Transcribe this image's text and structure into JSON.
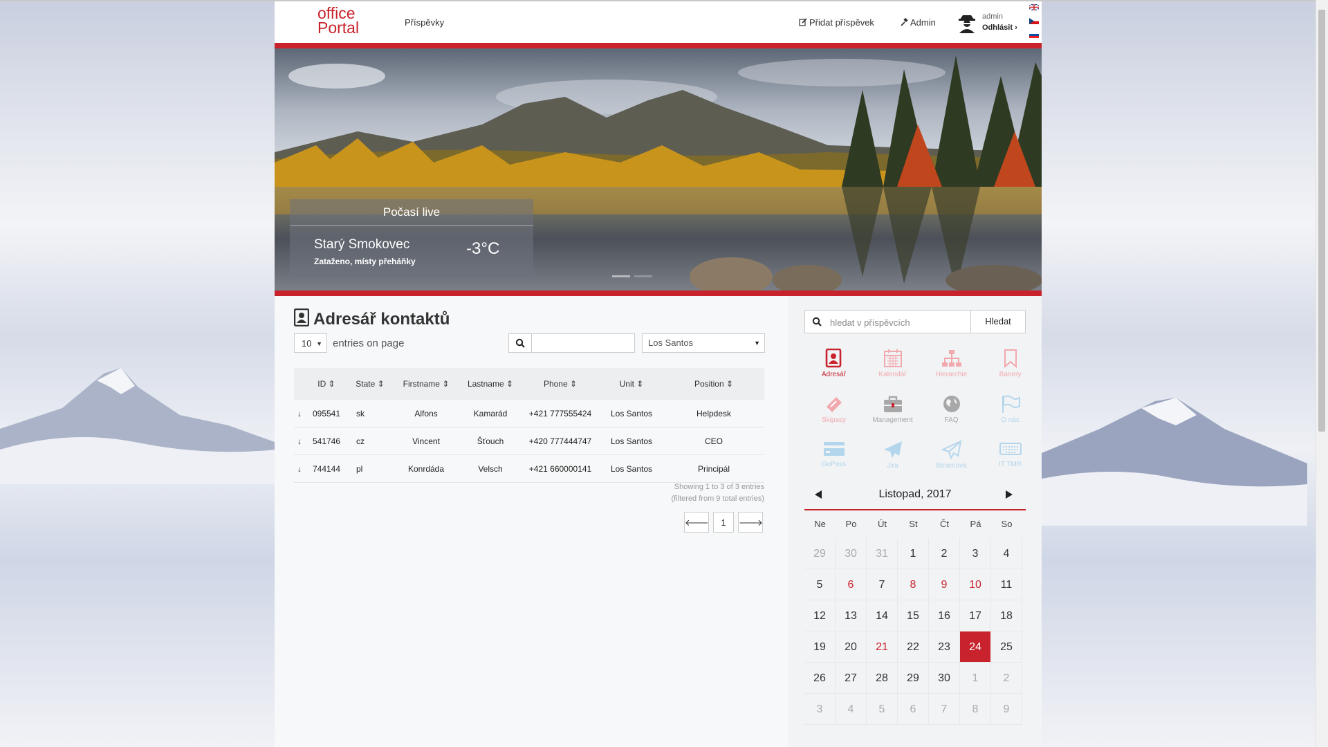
{
  "header": {
    "logo_line1": "office",
    "logo_line2": "Portal",
    "nav_posts": "Příspěvky",
    "add_post": "Přidat příspěvek",
    "admin_link": "Admin",
    "user_name": "admin",
    "logout": "Odhlásit"
  },
  "weather": {
    "title": "Počasí live",
    "city": "Starý Smokovec",
    "condition": "Zataženo, místy přeháňky",
    "temperature": "-3°C"
  },
  "main": {
    "title": "Adresář kontaktů",
    "page_length": "10",
    "entries_label": "entries on page",
    "unit_filter": "Los Santos",
    "columns": [
      "ID",
      "State",
      "Firstname",
      "Lastname",
      "Phone",
      "Unit",
      "Position"
    ],
    "rows": [
      {
        "id": "095541",
        "state": "sk",
        "firstname": "Alfons",
        "lastname": "Kamarád",
        "phone": "+421 777555424",
        "unit": "Los Santos",
        "position": "Helpdesk"
      },
      {
        "id": "541746",
        "state": "cz",
        "firstname": "Vincent",
        "lastname": "Šťouch",
        "phone": "+420 777444747",
        "unit": "Los Santos",
        "position": "CEO"
      },
      {
        "id": "744144",
        "state": "pl",
        "firstname": "Konrdáda",
        "lastname": "Velsch",
        "phone": "+421 660000141",
        "unit": "Los Santos",
        "position": "Principál"
      }
    ],
    "info_line1": "Showing 1 to 3 of 3 entries",
    "info_line2": "(filtered from 9 total entries)",
    "current_page": "1"
  },
  "sidebar": {
    "search_placeholder": "hledat v příspěvcích",
    "search_button": "Hledat",
    "apps": [
      {
        "label": "Adresář",
        "icon": "address-book-icon"
      },
      {
        "label": "Kalendář",
        "icon": "calendar-icon"
      },
      {
        "label": "Hierarchie",
        "icon": "sitemap-icon"
      },
      {
        "label": "Banery",
        "icon": "bookmark-icon"
      },
      {
        "label": "Skipasy",
        "icon": "ticket-icon"
      },
      {
        "label": "Management",
        "icon": "briefcase-icon"
      },
      {
        "label": "FAQ",
        "icon": "globe-icon"
      },
      {
        "label": "O nás",
        "icon": "flag-icon"
      },
      {
        "label": "GoPass",
        "icon": "credit-card-icon"
      },
      {
        "label": "Jira",
        "icon": "paper-plane-icon"
      },
      {
        "label": "Besenova",
        "icon": "paper-plane-outline-icon"
      },
      {
        "label": "IT TMR",
        "icon": "keyboard-icon"
      }
    ],
    "calendar": {
      "month": "Listopad, 2017",
      "weekdays": [
        "Ne",
        "Po",
        "Út",
        "St",
        "Čt",
        "Pá",
        "So"
      ],
      "days": [
        [
          "29",
          "30",
          "31",
          "1",
          "2",
          "3",
          "4"
        ],
        [
          "5",
          "6",
          "7",
          "8",
          "9",
          "10",
          "11"
        ],
        [
          "12",
          "13",
          "14",
          "15",
          "16",
          "17",
          "18"
        ],
        [
          "19",
          "20",
          "21",
          "22",
          "23",
          "24",
          "25"
        ],
        [
          "26",
          "27",
          "28",
          "29",
          "30",
          "1",
          "2"
        ],
        [
          "3",
          "4",
          "5",
          "6",
          "7",
          "8",
          "9"
        ]
      ],
      "today": "24",
      "accent": "#c8232c"
    }
  }
}
